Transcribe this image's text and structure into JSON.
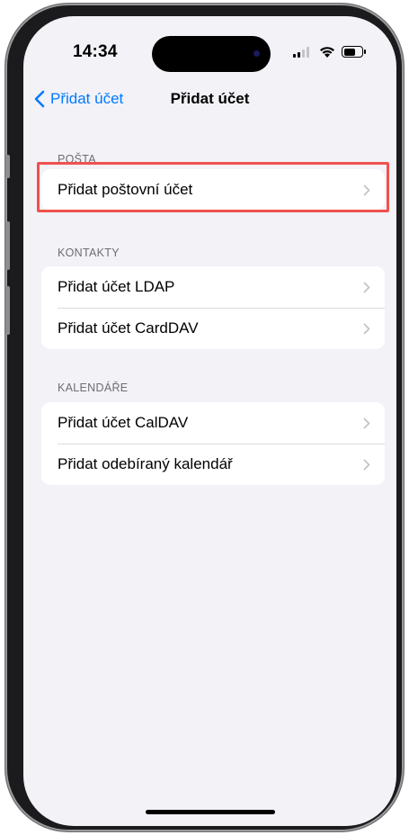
{
  "status_bar": {
    "time": "14:34",
    "battery_level": 0.65
  },
  "nav": {
    "back_label": "Přidat účet",
    "title": "Přidat účet"
  },
  "sections": {
    "mail": {
      "header": "POŠTA",
      "rows": [
        "Přidat poštovní účet"
      ]
    },
    "contacts": {
      "header": "KONTAKTY",
      "rows": [
        "Přidat účet LDAP",
        "Přidat účet CardDAV"
      ]
    },
    "calendars": {
      "header": "KALENDÁŘE",
      "rows": [
        "Přidat účet CalDAV",
        "Přidat odebíraný kalendář"
      ]
    }
  },
  "colors": {
    "accent": "#007aff",
    "background": "#f2f2f7",
    "highlight": "#f0524d"
  },
  "icons": {
    "back": "chevron-left-icon",
    "row": "chevron-right-icon",
    "signal": "signal-icon",
    "wifi": "wifi-icon",
    "battery": "battery-icon"
  }
}
